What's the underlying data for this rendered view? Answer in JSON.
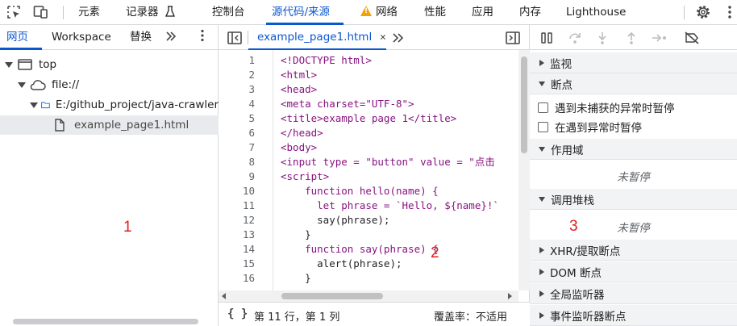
{
  "toolbar": {
    "tabs": [
      "元素",
      "记录器",
      "控制台",
      "源代码/来源",
      "网络",
      "性能",
      "应用",
      "内存",
      "Lighthouse"
    ],
    "active_tab": "源代码/来源",
    "recorder_icon": "flask-icon",
    "network_warning_icon": "warning-icon",
    "accent_color": "#0b57d0"
  },
  "navigator": {
    "tabs": [
      "网页",
      "Workspace",
      "替换"
    ],
    "active_tab": "网页",
    "tree": [
      {
        "label": "top",
        "icon": "window-icon",
        "expanded": true
      },
      {
        "label": "file://",
        "icon": "cloud-icon",
        "expanded": true
      },
      {
        "label": "E:/github_project/java-crawler",
        "icon": "folder-icon",
        "expanded": true
      },
      {
        "label": "example_page1.html",
        "icon": "file-icon",
        "selected": true
      }
    ],
    "panel_number": "1"
  },
  "editor": {
    "open_tab": "example_page1.html",
    "lines": [
      "<!DOCTYPE html>",
      "<html>",
      "<head>",
      "<meta charset=\"UTF-8\">",
      "<title>example page 1</title>",
      "</head>",
      "<body>",
      "<input type = \"button\" value = \"点击",
      "<script>",
      "    function hello(name) {",
      "      let phrase = `Hello, ${name}!`",
      "      say(phrase);",
      "    }",
      "    function say(phrase) {",
      "      alert(phrase);",
      "    }"
    ],
    "line_numbers": [
      "1",
      "2",
      "3",
      "4",
      "5",
      "6",
      "7",
      "8",
      "9",
      "10",
      "11",
      "12",
      "13",
      "14",
      "15",
      "16"
    ],
    "panel_number": "2",
    "status": {
      "format_icon": "curly-braces-icon",
      "position": "第 11 行，第 1 列",
      "coverage": "覆盖率：不适用"
    }
  },
  "debugger": {
    "sections": {
      "watch": "监视",
      "breakpoints": "断点",
      "scope": "作用域",
      "call_stack": "调用堆栈",
      "xhr": "XHR/提取断点",
      "dom": "DOM 断点",
      "global": "全局监听器",
      "event": "事件监听器断点"
    },
    "checkboxes": [
      "遇到未捕获的异常时暂停",
      "在遇到异常时暂停"
    ],
    "not_paused": "未暂停",
    "panel_number": "3"
  }
}
